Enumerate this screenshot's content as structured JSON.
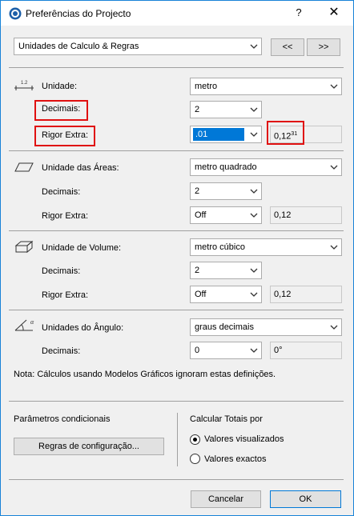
{
  "window": {
    "title": "Preferências do Projecto",
    "help": "?",
    "close": "✕"
  },
  "preset": {
    "value": "Unidades de Calculo & Regras",
    "prev": "<<",
    "next": ">>"
  },
  "length": {
    "unit_label": "Unidade:",
    "unit_value": "metro",
    "decimals_label": "Decimais:",
    "decimals_value": "2",
    "extra_label": "Rigor Extra:",
    "extra_value": ".01",
    "preview": "0,12",
    "preview_sup": "31"
  },
  "area": {
    "unit_label": "Unidade das Áreas:",
    "unit_value": "metro quadrado",
    "decimals_label": "Decimais:",
    "decimals_value": "2",
    "extra_label": "Rigor Extra:",
    "extra_value": "Off",
    "preview": "0,12"
  },
  "volume": {
    "unit_label": "Unidade de Volume:",
    "unit_value": "metro cúbico",
    "decimals_label": "Decimais:",
    "decimals_value": "2",
    "extra_label": "Rigor Extra:",
    "extra_value": "Off",
    "preview": "0,12"
  },
  "angle": {
    "unit_label": "Unidades do Ângulo:",
    "unit_value": "graus decimais",
    "decimals_label": "Decimais:",
    "decimals_value": "0",
    "preview": "0°"
  },
  "note": "Nota: Cálculos usando Modelos Gráficos ignoram estas definições.",
  "conditional": {
    "title": "Parâmetros condicionais",
    "button": "Regras de configuração..."
  },
  "totals": {
    "title": "Calcular Totais por",
    "option1": "Valores visualizados",
    "option2": "Valores exactos",
    "selected": "Valores visualizados"
  },
  "footer": {
    "cancel": "Cancelar",
    "ok": "OK"
  },
  "icons": {
    "length": "length-dimension-icon",
    "area": "area-icon",
    "volume": "volume-icon",
    "angle": "angle-icon"
  },
  "colors": {
    "highlight": "#e01010",
    "selection": "#0078d7",
    "titlebar_border": "#1883d7"
  }
}
